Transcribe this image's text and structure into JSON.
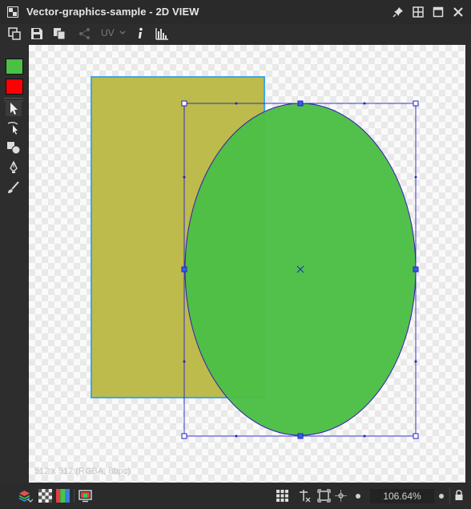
{
  "window": {
    "title": "Vector-graphics-sample - 2D VIEW"
  },
  "toolbar": {
    "uv_label": "UV"
  },
  "colors": {
    "foreground": "#4bbf46",
    "background": "#ff0000",
    "rectangle_fill": "#bdbb4b",
    "ellipse_fill": "#4bbf46",
    "selection": "#2323c8"
  },
  "canvas": {
    "image_info": "512 x 512 (RGBA, 8bpc)"
  },
  "statusbar": {
    "zoom_value": "106.64%"
  }
}
